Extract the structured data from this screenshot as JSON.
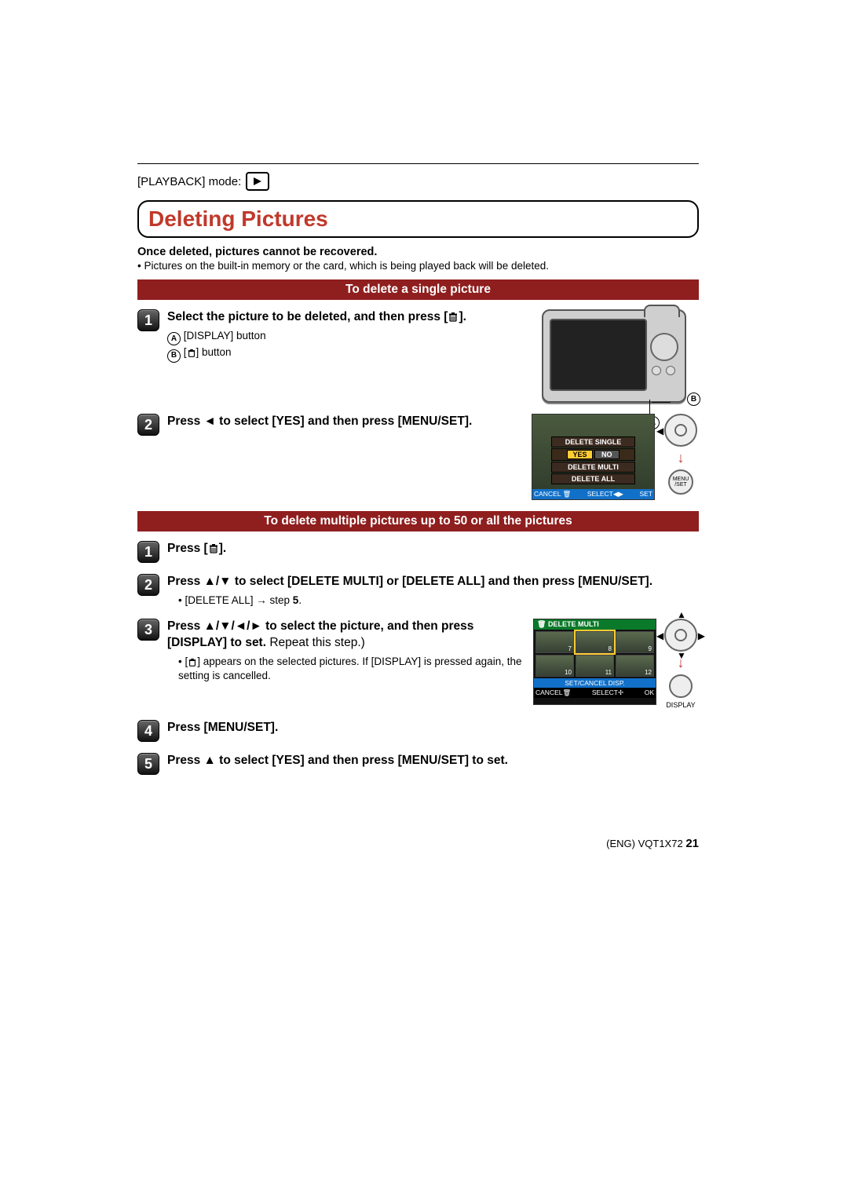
{
  "mode": {
    "label": "[PLAYBACK] mode:"
  },
  "title": "Deleting Pictures",
  "warning": "Once deleted, pictures cannot be recovered.",
  "note": "• Pictures on the built-in memory or the card, which is being played back will be deleted.",
  "section_single": "To delete a single picture",
  "single": {
    "step1": {
      "text_a": "Select the picture to be deleted, and then press [",
      "text_b": "].",
      "sub_a_label": "[DISPLAY] button",
      "sub_b_label_a": "[",
      "sub_b_label_b": "] button"
    },
    "step2": {
      "text": "Press ◄ to select [YES] and then press [MENU/SET]."
    }
  },
  "callout": {
    "a": "A",
    "b": "B"
  },
  "screen1": {
    "row1": "DELETE SINGLE",
    "yes": "YES",
    "no": "NO",
    "row2": "DELETE MULTI",
    "row3": "DELETE ALL",
    "cancel": "CANCEL",
    "select": "SELECT",
    "set": "SET"
  },
  "navpad": {
    "menu_set": "MENU /SET",
    "display": "DISPLAY"
  },
  "section_multi": "To delete multiple pictures up to 50 or all the pictures",
  "multi": {
    "step1_a": "Press [",
    "step1_b": "].",
    "step2": "Press ▲/▼ to select [DELETE MULTI] or [DELETE ALL] and then press [MENU/SET].",
    "step2_sub_a": "• [DELETE ALL] → step ",
    "step2_sub_b": "5",
    "step2_sub_c": ".",
    "step3_a": "Press ▲/▼/◄/► to select the picture, and then press [DISPLAY] to set.",
    "step3_b": " Repeat this step.)",
    "step3_sub_a": "• [",
    "step3_sub_b": "] appears on the selected pictures. If [DISPLAY] is pressed again, the setting is cancelled.",
    "step4": "Press [MENU/SET].",
    "step5": "Press ▲ to select [YES] and then press [MENU/SET] to set."
  },
  "screen2": {
    "head": "DELETE MULTI",
    "nums": [
      "7",
      "8",
      "9",
      "10",
      "11",
      "12"
    ],
    "bar": "SET/CANCEL DISP.",
    "cancel": "CANCEL",
    "select": "SELECT",
    "ok": "OK"
  },
  "footer": {
    "left": "(ENG) VQT1X72",
    "page": "21"
  }
}
